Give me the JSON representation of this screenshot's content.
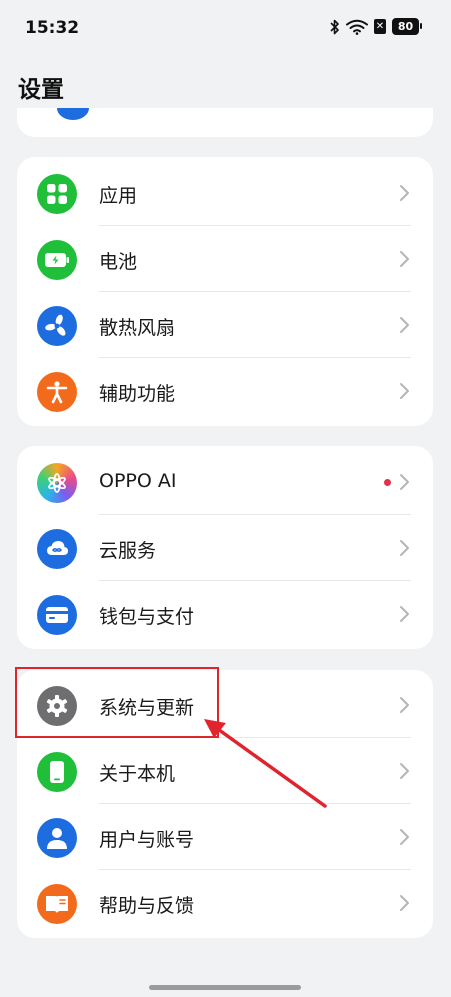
{
  "status_bar": {
    "time": "15:32",
    "battery": "80",
    "sim": "✕"
  },
  "page_title": "设置",
  "groups": [
    {
      "items": [
        {
          "label": "应用",
          "icon": "apps-grid-icon",
          "color": "#1fbf3a"
        },
        {
          "label": "电池",
          "icon": "battery-icon",
          "color": "#1fbf3a"
        },
        {
          "label": "散热风扇",
          "icon": "fan-icon",
          "color": "#1e6de0"
        },
        {
          "label": "辅助功能",
          "icon": "accessibility-icon",
          "color": "#f26b1d"
        }
      ]
    },
    {
      "items": [
        {
          "label": "OPPO AI",
          "icon": "oppo-ai-icon",
          "badge": "new-dot"
        },
        {
          "label": "云服务",
          "icon": "cloud-icon",
          "color": "#1e6de0"
        },
        {
          "label": "钱包与支付",
          "icon": "wallet-icon",
          "color": "#1e6de0"
        }
      ]
    },
    {
      "items": [
        {
          "label": "系统与更新",
          "icon": "gear-icon",
          "color": "#6e6e70",
          "highlighted": true
        },
        {
          "label": "关于本机",
          "icon": "phone-icon",
          "color": "#1fbf3a"
        },
        {
          "label": "用户与账号",
          "icon": "user-icon",
          "color": "#1e6de0"
        },
        {
          "label": "帮助与反馈",
          "icon": "help-book-icon",
          "color": "#f26b1d"
        }
      ]
    }
  ],
  "annotation": {
    "color": "#e0242e"
  }
}
